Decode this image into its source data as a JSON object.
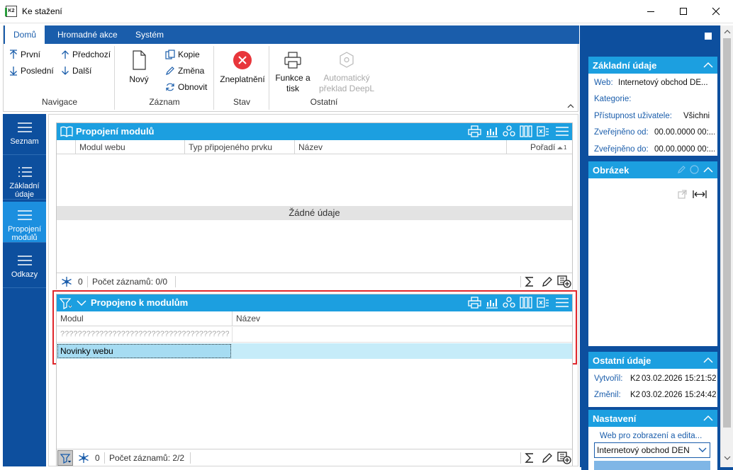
{
  "window": {
    "title": "Ke stažení",
    "app_icon_text": "K2"
  },
  "ribbon": {
    "tabs": [
      "Domů",
      "Hromadné akce",
      "Systém"
    ],
    "groups": {
      "navigace": {
        "title": "Navigace",
        "first": "První",
        "prev": "Předchozí",
        "last": "Poslední",
        "next": "Další"
      },
      "zaznam": {
        "title": "Záznam",
        "new": "Nový",
        "copy": "Kopie",
        "change": "Změna",
        "refresh": "Obnovit"
      },
      "stav": {
        "title": "Stav",
        "invalidate": "Zneplatnění"
      },
      "ostatni": {
        "title": "Ostatní",
        "print_line1": "Funkce a",
        "print_line2": "tisk",
        "deepl_line1": "Automatický",
        "deepl_line2": "překlad DeepL"
      }
    }
  },
  "nav": {
    "items": [
      {
        "line1": "Seznam",
        "line2": ""
      },
      {
        "line1": "Základní",
        "line2": "údaje"
      },
      {
        "line1": "Propojení",
        "line2": "modulů"
      },
      {
        "line1": "Odkazy",
        "line2": ""
      }
    ],
    "active_index": 2
  },
  "panel1": {
    "title": "Propojení modulů",
    "columns": [
      "Modul webu",
      "Typ připojeného prvku",
      "Název",
      "Pořadí"
    ],
    "sort_marker": "1",
    "empty_text": "Žádné údaje",
    "footer": {
      "count": "0",
      "records": "Počet záznamů: 0/0"
    }
  },
  "panel2": {
    "title": "Propojeno k modulům",
    "columns": [
      "Modul",
      "Název"
    ],
    "rows": [
      {
        "modul": "???????????????????????????????????????",
        "nazev": ""
      },
      {
        "modul": "Novinky webu",
        "nazev": ""
      }
    ],
    "footer": {
      "count": "0",
      "records": "Počet záznamů: 2/2"
    }
  },
  "right": {
    "zakladni": {
      "title": "Základní údaje",
      "web_label": "Web:",
      "web_value": "Internetový obchod DE...",
      "kategorie_label": "Kategorie:",
      "pristupnost_label": "Přístupnost uživatele:",
      "pristupnost_value": "Všichni",
      "zverejneno_od_label": "Zveřejněno od:",
      "zverejneno_od_value": "00.00.0000 00:...",
      "zverejneno_do_label": "Zveřejněno do:",
      "zverejneno_do_value": "00.00.0000 00:..."
    },
    "obrazek": {
      "title": "Obrázek"
    },
    "ostatni": {
      "title": "Ostatní údaje",
      "vytvoril_label": "Vytvořil:",
      "vytvoril_user": "K2",
      "vytvoril_date": "03.02.2026 15:21:52",
      "zmenil_label": "Změnil:",
      "zmenil_user": "K2",
      "zmenil_date": "03.02.2026 15:24:42"
    },
    "nastaveni": {
      "title": "Nastavení",
      "field_label": "Web pro zobrazení a edita...",
      "field_value": "Internetový obchod DEN"
    }
  },
  "colors": {
    "ribbon_blue": "#1a5dab",
    "header_blue": "#1c9fe0",
    "nav_blue": "#0d4f9e",
    "selection": "#c6ecf9",
    "highlight_border": "#e0262b"
  }
}
